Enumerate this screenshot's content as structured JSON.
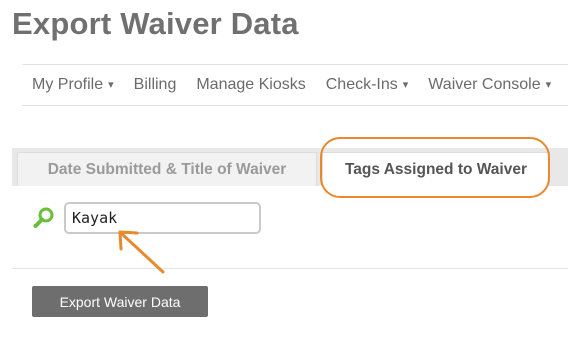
{
  "page": {
    "title": "Export Waiver Data"
  },
  "nav": {
    "items": [
      {
        "label": "My Profile",
        "has_dropdown": true
      },
      {
        "label": "Billing",
        "has_dropdown": false
      },
      {
        "label": "Manage Kiosks",
        "has_dropdown": false
      },
      {
        "label": "Check-Ins",
        "has_dropdown": true
      },
      {
        "label": "Waiver Console",
        "has_dropdown": true
      }
    ],
    "dropdown_glyph": "▾"
  },
  "tabs": [
    {
      "label": "Date Submitted & Title of Waiver",
      "active": false
    },
    {
      "label": "Tags Assigned to Waiver",
      "active": true
    }
  ],
  "search": {
    "value": "Kayak",
    "icon": "magnifier-icon"
  },
  "annotation": {
    "color": "#e8892b"
  },
  "export_button": {
    "label": "Export Waiver Data"
  },
  "colors": {
    "button_bg": "#6e6e6e",
    "search_icon": "#6abf3a",
    "title": "#707070"
  }
}
